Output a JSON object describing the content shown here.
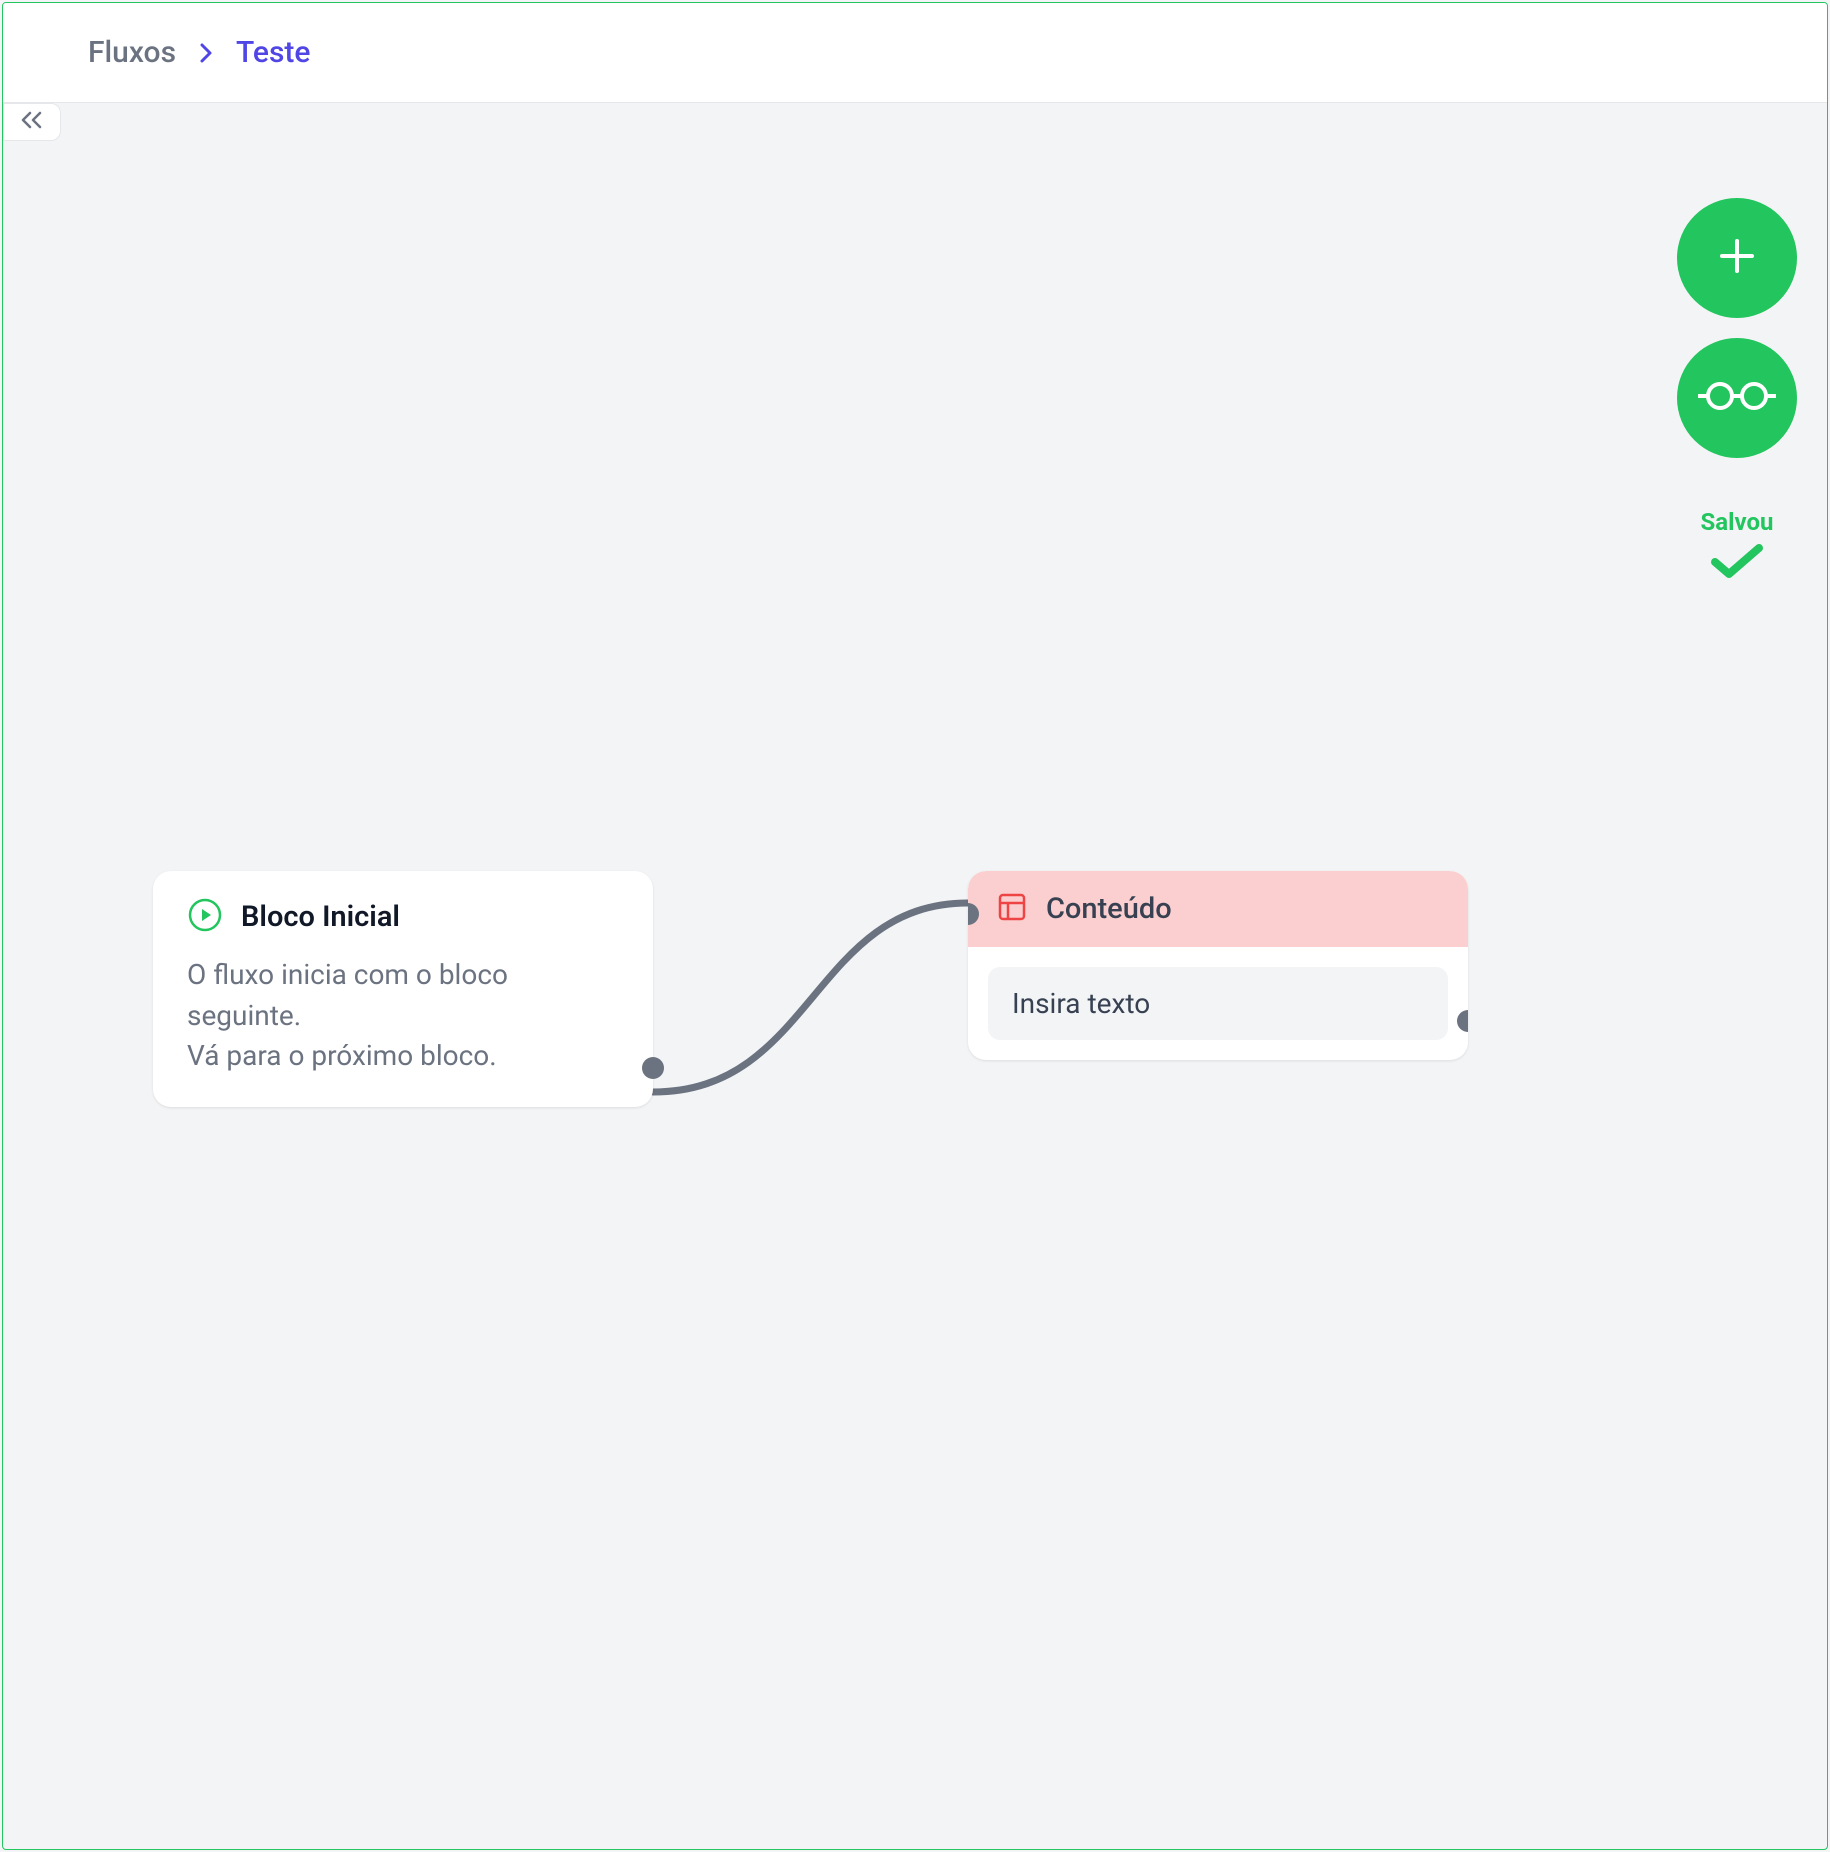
{
  "breadcrumb": {
    "root": "Fluxos",
    "current": "Teste"
  },
  "save_status": {
    "label": "Salvou"
  },
  "nodes": {
    "start": {
      "title": "Bloco Inicial",
      "line1": "O fluxo inicia com o bloco seguinte.",
      "line2": "Vá para o próximo bloco."
    },
    "content": {
      "title": "Conteúdo",
      "placeholder": "Insira texto"
    }
  },
  "icons": {
    "play": "play-icon",
    "layout": "layout-icon",
    "plus": "plus-icon",
    "preview": "glasses-icon",
    "check": "check-icon",
    "collapse": "double-chevron-left-icon",
    "chevron": "chevron-right-icon"
  },
  "colors": {
    "accent_green": "#22c55e",
    "accent_indigo": "#4f46e5",
    "node_content_header": "#fbcfcf",
    "port": "#6b7280"
  }
}
